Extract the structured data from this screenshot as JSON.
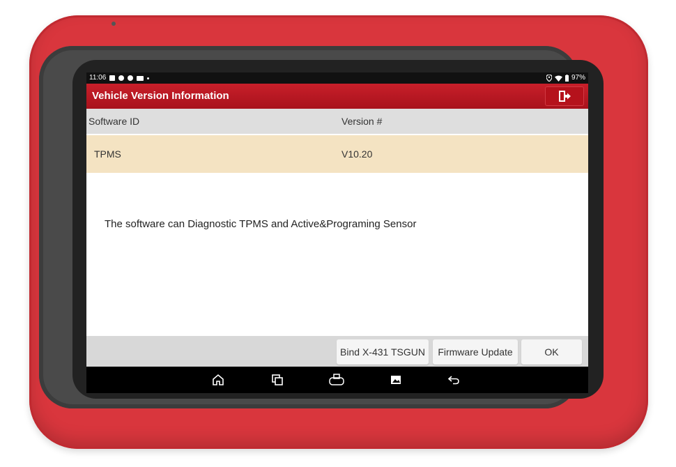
{
  "status_bar": {
    "time": "11:06",
    "left_icons": [
      "image-icon",
      "gear-icon",
      "gear-icon",
      "mail-icon",
      "dot-icon"
    ],
    "right_icons": [
      "location-icon",
      "wifi-icon",
      "battery-icon"
    ],
    "battery": "97%"
  },
  "header": {
    "title": "Vehicle Version Information",
    "exit_icon": "exit-icon"
  },
  "table": {
    "columns": [
      "Software ID",
      "Version #"
    ],
    "rows": [
      {
        "software_id": "TPMS",
        "version": "V10.20"
      }
    ]
  },
  "description": "The software can Diagnostic TPMS and Active&Programing Sensor",
  "footer": {
    "bind_label": "Bind X-431 TSGUN",
    "firmware_label": "Firmware Update",
    "ok_label": "OK"
  },
  "nav_bar": {
    "icons": [
      "home-icon",
      "recents-icon",
      "vci-icon",
      "screenshot-icon",
      "back-icon"
    ]
  },
  "colors": {
    "case": "#d9363d",
    "header": "#b5121c",
    "selected_row": "#f4e3c2"
  }
}
